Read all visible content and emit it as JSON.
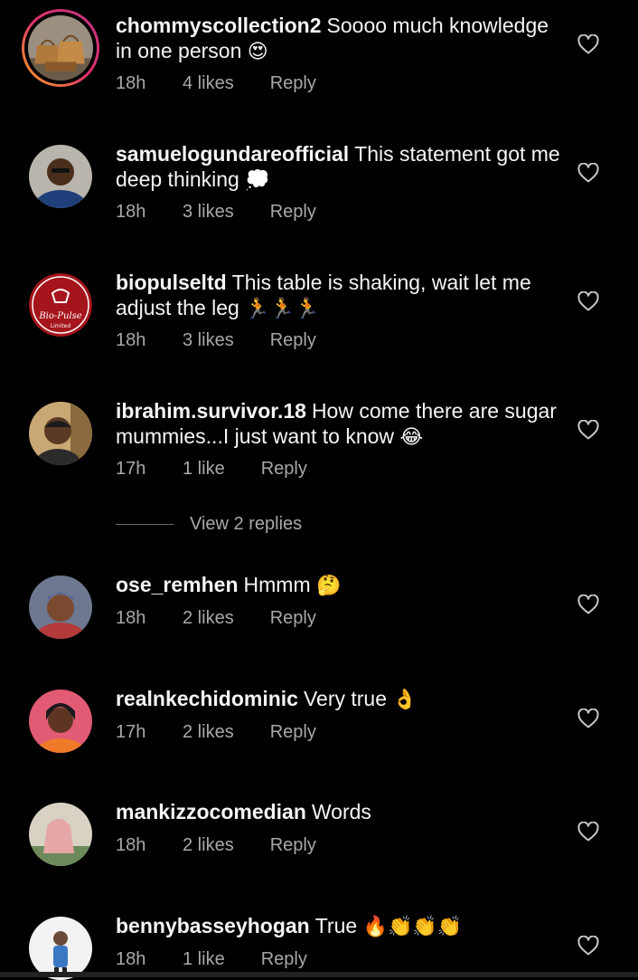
{
  "comments": [
    {
      "username": "chommyscollection2",
      "text": "Soooo much knowledge in one person",
      "emoji": "😍",
      "time": "18h",
      "likes": "4 likes",
      "reply": "Reply"
    },
    {
      "username": "samuelogundareofficial",
      "text": "This statement got me deep thinking",
      "emoji": "💭",
      "time": "18h",
      "likes": "3 likes",
      "reply": "Reply"
    },
    {
      "username": "biopulseltd",
      "text": "This table is shaking, wait let me adjust the leg",
      "emoji": "🏃🏃🏃",
      "time": "18h",
      "likes": "3 likes",
      "reply": "Reply",
      "avatar_text": "Bio-Pulse",
      "avatar_subtext": "Limited"
    },
    {
      "username": "ibrahim.survivor.18",
      "text": "How come there are sugar mummies...I just want to know",
      "emoji": "😂",
      "time": "17h",
      "likes": "1 like",
      "reply": "Reply"
    },
    {
      "username": "ose_remhen",
      "text": "Hmmm",
      "emoji": "🤔",
      "time": "18h",
      "likes": "2 likes",
      "reply": "Reply"
    },
    {
      "username": "realnkechidominic",
      "text": "Very true",
      "emoji": "👌",
      "time": "17h",
      "likes": "2 likes",
      "reply": "Reply"
    },
    {
      "username": "mankizzocomedian",
      "text": "Words",
      "emoji": "",
      "time": "18h",
      "likes": "2 likes",
      "reply": "Reply"
    },
    {
      "username": "bennybasseyhogan",
      "text": "True",
      "emoji": "🔥👏👏👏",
      "time": "18h",
      "likes": "1 like",
      "reply": "Reply"
    }
  ],
  "view_replies": "View 2 replies",
  "colors": {
    "background": "#000000",
    "text": "#f5f5f5",
    "secondary": "#a8a8a8",
    "story_ring": "#e1306c",
    "biopulse_red": "#a5151b"
  },
  "icons": {
    "like": "heart-outline-icon"
  }
}
